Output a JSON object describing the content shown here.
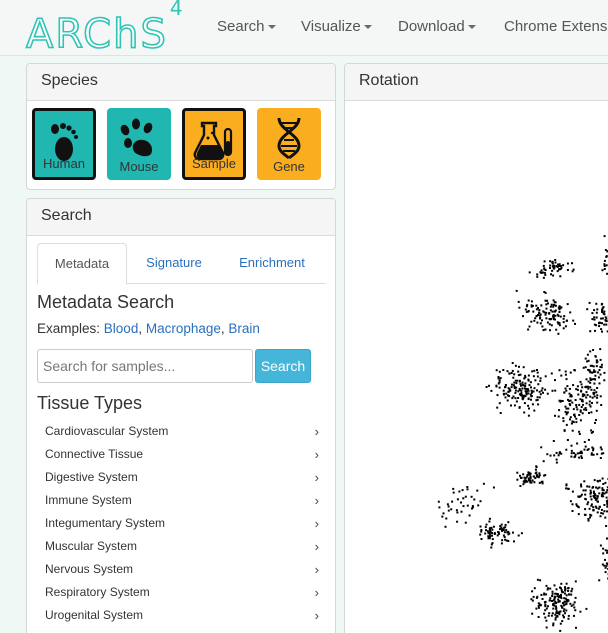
{
  "nav": {
    "logo": "ARChS",
    "logo_version": "4",
    "items": [
      "Search",
      "Visualize",
      "Download",
      "Chrome Extension"
    ]
  },
  "species": {
    "title": "Species",
    "tiles": [
      {
        "label": "Human",
        "color": "#21b7b1",
        "selected": true,
        "icon": "footprint-icon"
      },
      {
        "label": "Mouse",
        "color": "#21b7b1",
        "selected": false,
        "icon": "paw-icon"
      },
      {
        "label": "Sample",
        "color": "#fbad20",
        "selected": true,
        "icon": "flask-icon"
      },
      {
        "label": "Gene",
        "color": "#fbad20",
        "selected": false,
        "icon": "dna-icon"
      }
    ]
  },
  "search": {
    "title": "Search",
    "tabs": [
      "Metadata",
      "Signature",
      "Enrichment"
    ],
    "active_tab": "Metadata",
    "metadata_title": "Metadata Search",
    "examples_label": "Examples:",
    "examples": [
      "Blood",
      "Macrophage",
      "Brain"
    ],
    "placeholder": "Search for samples...",
    "button": "Search",
    "tissue_title": "Tissue Types",
    "tissues": [
      "Cardiovascular System",
      "Connective Tissue",
      "Digestive System",
      "Immune System",
      "Integumentary System",
      "Muscular System",
      "Nervous System",
      "Respiratory System",
      "Urogenital System"
    ]
  },
  "rotation": {
    "title": "Rotation"
  }
}
